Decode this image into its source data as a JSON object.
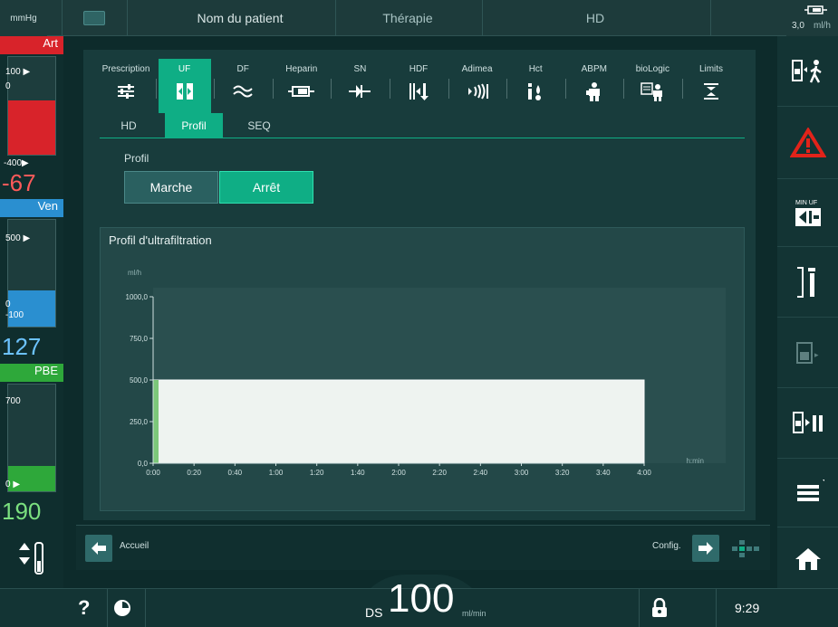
{
  "top": {
    "unit": "mmHg",
    "patient": "Nom du patient",
    "therapy": "Thérapie",
    "mode": "HD",
    "flow_value": "3,0",
    "flow_unit": "ml/h"
  },
  "left": {
    "art": {
      "label": "Art",
      "upper": "100",
      "lower_mark": "0",
      "lower": "-400",
      "value": "-67"
    },
    "ven": {
      "label": "Ven",
      "upper": "500",
      "lower_mark": "0",
      "lower": "-100",
      "value": "127"
    },
    "pbe": {
      "label": "PBE",
      "upper": "700",
      "lower": "0",
      "value": "190"
    }
  },
  "tabs": [
    {
      "label": "Prescription",
      "icon": "sliders-icon"
    },
    {
      "label": "UF",
      "icon": "uf-filter-icon",
      "active": true
    },
    {
      "label": "DF",
      "icon": "wave-icon"
    },
    {
      "label": "Heparin",
      "icon": "syringe-icon"
    },
    {
      "label": "SN",
      "icon": "single-needle-icon"
    },
    {
      "label": "HDF",
      "icon": "hdf-icon"
    },
    {
      "label": "Adimea",
      "icon": "adimea-icon"
    },
    {
      "label": "Hct",
      "icon": "hct-icon"
    },
    {
      "label": "ABPM",
      "icon": "abpm-icon"
    },
    {
      "label": "bioLogic",
      "icon": "biologic-icon"
    },
    {
      "label": "Limits",
      "icon": "limits-icon"
    }
  ],
  "subtabs": [
    "HD",
    "Profil",
    "SEQ"
  ],
  "profil": {
    "label": "Profil",
    "on": "Marche",
    "off": "Arrêt"
  },
  "chart_data": {
    "type": "area",
    "title": "Profil d'ultrafiltration",
    "ylabel": "ml/h",
    "xlabel": "h:min",
    "ylim": [
      0,
      1000
    ],
    "yticks": [
      "0,0",
      "250,0",
      "500,0",
      "750,0",
      "1000,0"
    ],
    "xticks": [
      "0:00",
      "0:20",
      "0:40",
      "1:00",
      "1:20",
      "1:40",
      "2:00",
      "2:20",
      "2:40",
      "3:00",
      "3:20",
      "3:40",
      "4:00"
    ],
    "x_minutes": [
      0,
      240
    ],
    "series": [
      {
        "x": [
          "0:00",
          "4:00"
        ],
        "values": [
          500,
          500
        ]
      }
    ]
  },
  "nav": {
    "back": "Accueil",
    "forward": "Config."
  },
  "status": {
    "ds_label": "DS",
    "ds_value": "100",
    "ds_unit": "ml/min",
    "time": "9:29",
    "help": "?"
  },
  "colors": {
    "accent": "#0fae85",
    "art": "#d8232a",
    "ven": "#2a8fd0",
    "pbe": "#2ea83a",
    "alarm": "#e2231a"
  }
}
